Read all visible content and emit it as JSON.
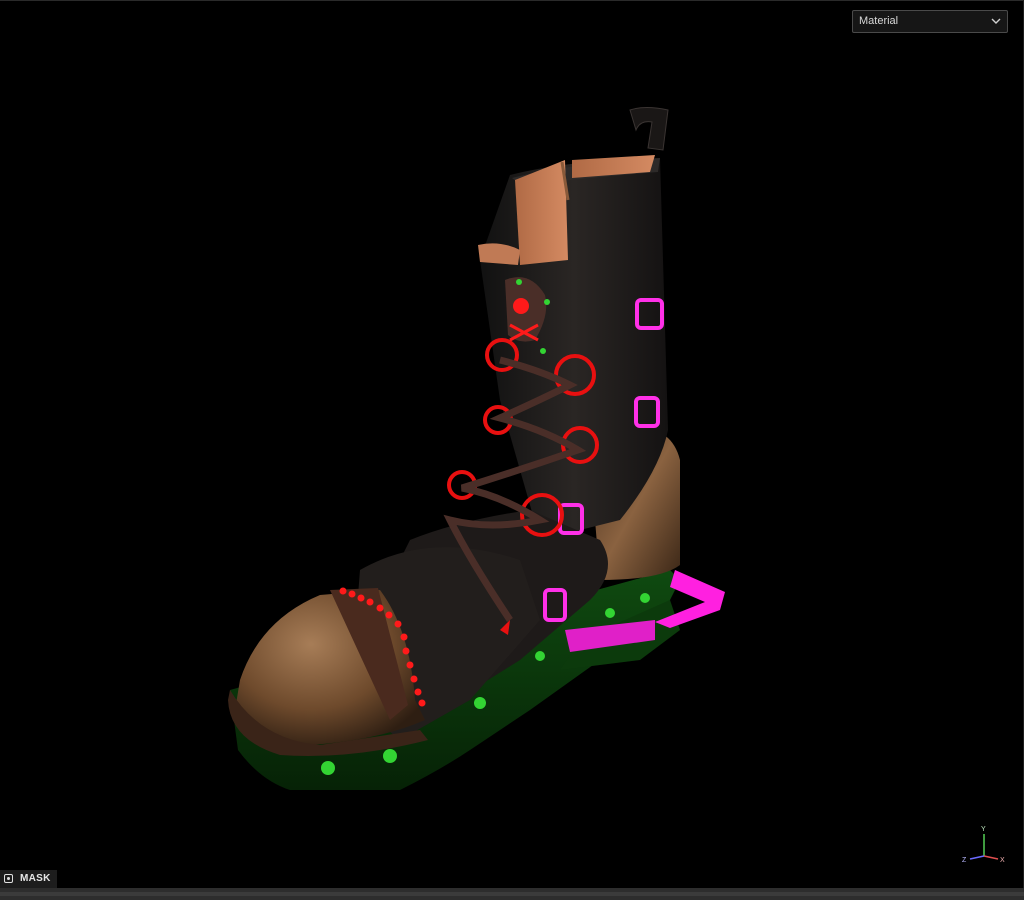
{
  "viewport": {
    "shading_dropdown": {
      "selected": "Material"
    },
    "mask_toggle": {
      "label": "MASK"
    },
    "axis_gizmo": {
      "y_label": "Y",
      "z_label": "Z",
      "x_label": "X"
    }
  },
  "colors": {
    "background": "#000000",
    "leather_black": "#1e1a19",
    "leather_brown": "#6e4a2c",
    "mask_red": "#ff1010",
    "mask_green": "#19c21b",
    "mask_magenta": "#ff20e0",
    "sole_green": "#0b3a0b"
  }
}
